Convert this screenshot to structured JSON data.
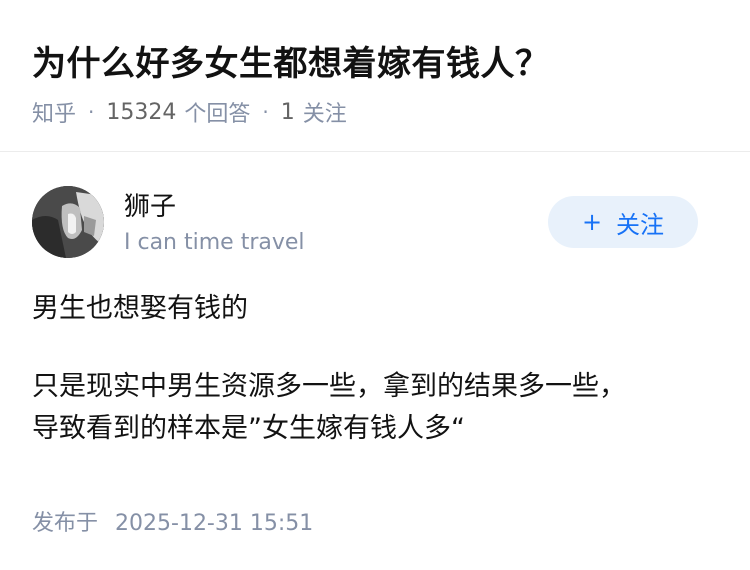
{
  "question": {
    "title": "为什么好多女生都想着嫁有钱人？",
    "source": "知乎",
    "answer_count": "15324",
    "answer_label": "个回答",
    "follow_count": "1",
    "follow_label": "关注"
  },
  "author": {
    "name": "狮子",
    "bio": "I can time travel"
  },
  "follow_button": {
    "plus": "+",
    "label": "关注"
  },
  "answer": {
    "paragraphs": [
      "男生也想娶有钱的",
      "只是现实中男生资源多一些，拿到的结果多一些，",
      "导致看到的样本是”女生嫁有钱人多“"
    ]
  },
  "publish": {
    "label": "发布于",
    "datetime": "2025-12-31 15:51"
  },
  "colors": {
    "accent": "#1772f6",
    "follow_bg": "#e8f1fb",
    "meta_gray": "#8590a6"
  },
  "icons": {
    "avatar": "user-avatar-photo"
  }
}
